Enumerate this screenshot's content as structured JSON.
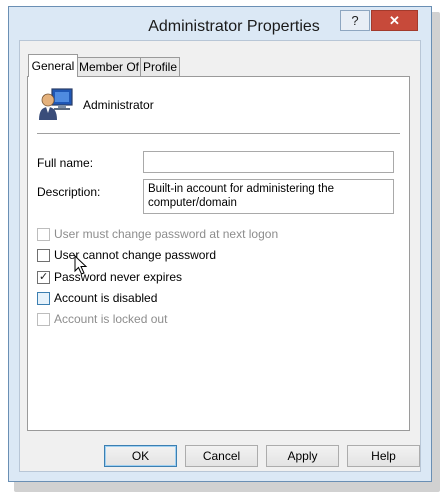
{
  "window": {
    "title": "Administrator Properties",
    "help_label": "?",
    "close_label": "✕"
  },
  "tabs": [
    {
      "label": "General",
      "active": true
    },
    {
      "label": "Member Of",
      "active": false
    },
    {
      "label": "Profile",
      "active": false
    }
  ],
  "general": {
    "icon": "user-account-icon",
    "username": "Administrator",
    "full_name": {
      "label": "Full name:",
      "value": ""
    },
    "description": {
      "label": "Description:",
      "value": "Built-in account for administering the computer/domain"
    },
    "checkboxes": [
      {
        "label": "User must change password at next logon",
        "checked": false,
        "enabled": false
      },
      {
        "label": "User cannot change password",
        "checked": false,
        "enabled": true
      },
      {
        "label": "Password never expires",
        "checked": true,
        "enabled": true
      },
      {
        "label": "Account is disabled",
        "checked": false,
        "enabled": true
      },
      {
        "label": "Account is locked out",
        "checked": false,
        "enabled": false
      }
    ]
  },
  "buttons": {
    "ok": "OK",
    "cancel": "Cancel",
    "apply": "Apply",
    "help": "Help"
  },
  "colors": {
    "window_frame": "#dbe8f5",
    "close_button": "#c74a3a",
    "default_button_border": "#3c7fb1"
  }
}
